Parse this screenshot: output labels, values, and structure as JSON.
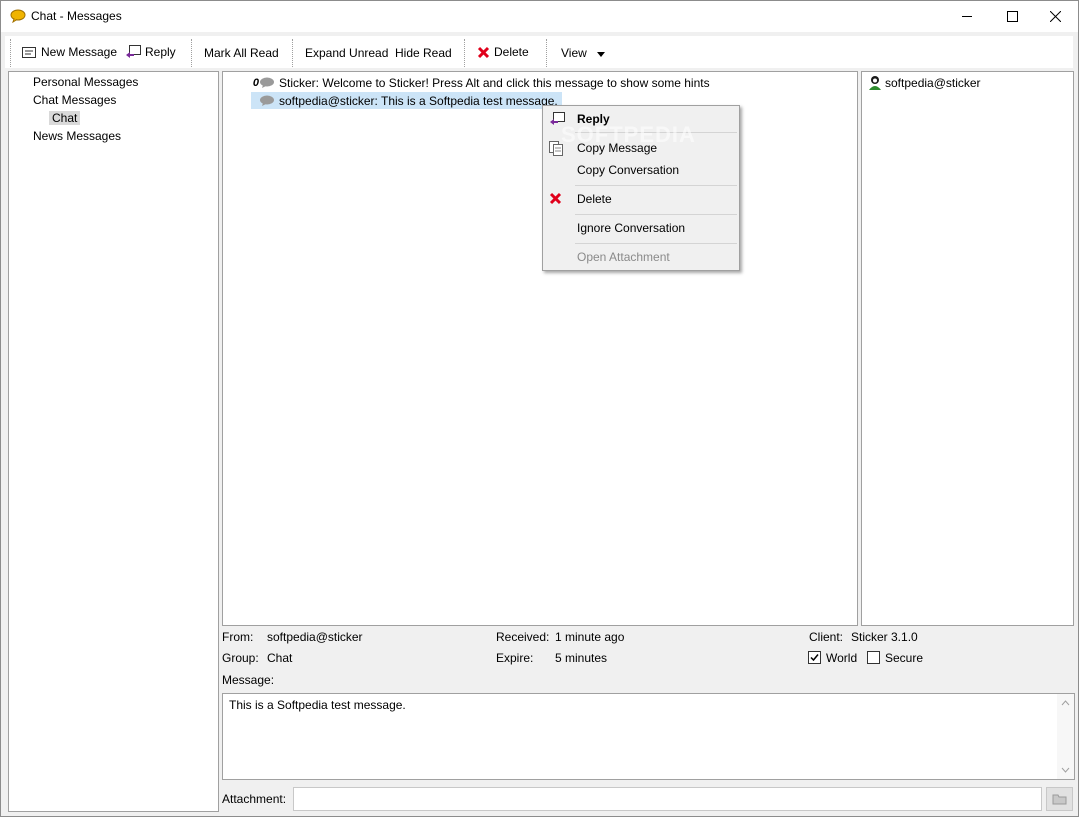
{
  "window": {
    "title": "Chat - Messages"
  },
  "toolbar": {
    "new_message": "New Message",
    "reply": "Reply",
    "mark_all_read": "Mark All Read",
    "expand_unread": "Expand Unread",
    "hide_read": "Hide Read",
    "delete": "Delete",
    "view": "View"
  },
  "tree": {
    "items": [
      {
        "label": "Personal Messages"
      },
      {
        "label": "Chat Messages"
      },
      {
        "label": "Chat"
      },
      {
        "label": "News Messages"
      }
    ]
  },
  "messages": [
    {
      "badge": "0",
      "text": "Sticker: Welcome to Sticker! Press Alt and click this message to show some hints"
    },
    {
      "text": "softpedia@sticker: This is a Softpedia test message."
    }
  ],
  "contacts": [
    {
      "name": "softpedia@sticker"
    }
  ],
  "details": {
    "from_label": "From:",
    "from": "softpedia@sticker",
    "group_label": "Group:",
    "group": "Chat",
    "received_label": "Received:",
    "received": "1 minute ago",
    "expire_label": "Expire:",
    "expire": "5 minutes",
    "client_label": "Client:",
    "client": "Sticker 3.1.0",
    "world_label": "World",
    "world_checked": true,
    "secure_label": "Secure",
    "secure_checked": false,
    "message_label": "Message:",
    "message_body": "This is a Softpedia test message.",
    "attachment_label": "Attachment:",
    "attachment_value": ""
  },
  "context_menu": {
    "items": [
      {
        "label": "Reply",
        "icon": "reply-icon"
      },
      {
        "label": "Copy Message",
        "icon": "copy-icon"
      },
      {
        "label": "Copy Conversation"
      },
      {
        "label": "Delete",
        "icon": "delete-icon"
      },
      {
        "label": "Ignore Conversation"
      },
      {
        "label": "Open Attachment",
        "disabled": true
      }
    ]
  },
  "watermark": "SOFTPEDIA",
  "colors": {
    "selection": "#cce4f7",
    "delete_red": "#e0001b",
    "chat_bubble": "#f0b400"
  }
}
